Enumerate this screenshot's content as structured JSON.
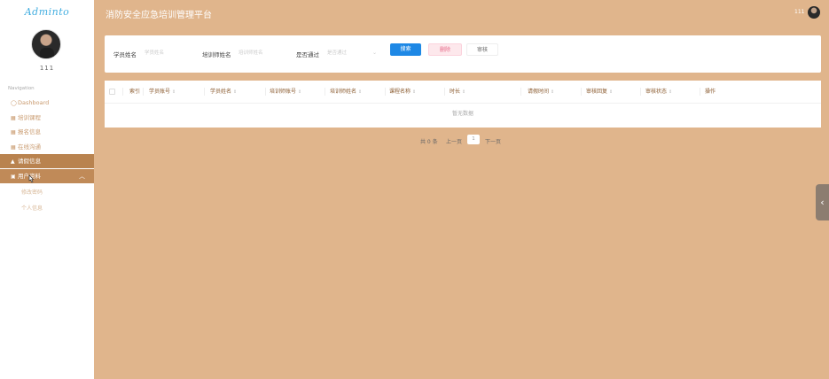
{
  "app": {
    "logo": "Adminto",
    "title": "消防安全应急培训管理平台",
    "top_user": "111"
  },
  "sidebar": {
    "username": "111",
    "nav_heading": "Navigation",
    "items": [
      {
        "label": "Dashboard",
        "icon": "dashboard-icon"
      },
      {
        "label": "培训课程",
        "icon": "grid-icon"
      },
      {
        "label": "报名信息",
        "icon": "grid-icon"
      },
      {
        "label": "在线沟通",
        "icon": "grid-icon"
      },
      {
        "label": "请假信息",
        "icon": "lock-icon"
      },
      {
        "label": "用户资料",
        "icon": "user-card-icon"
      }
    ],
    "sub_items": [
      {
        "label": "修改密码"
      },
      {
        "label": "个人信息"
      }
    ]
  },
  "search": {
    "student_name_label": "学员姓名",
    "student_name_placeholder": "学员姓名",
    "trainer_name_label": "培训师姓名",
    "trainer_name_placeholder": "培训师姓名",
    "passed_label": "是否通过",
    "passed_placeholder": "是否通过",
    "search_button": "搜索",
    "delete_button": "删除",
    "audit_button": "审核"
  },
  "table": {
    "columns": [
      "索引",
      "学员账号",
      "学员姓名",
      "培训师账号",
      "培训师姓名",
      "课程名称",
      "时长",
      "请假时间",
      "审核回复",
      "审核状态",
      "操作"
    ],
    "empty_text": "暂无数据"
  },
  "pagination": {
    "total": "共 0 条",
    "prev": "上一页",
    "page": "1",
    "next": "下一页"
  },
  "colors": {
    "background": "#e0b58c",
    "active_nav": "#b9834f",
    "primary_button": "#1e88e5",
    "delete_button_bg": "#fde8ec"
  }
}
